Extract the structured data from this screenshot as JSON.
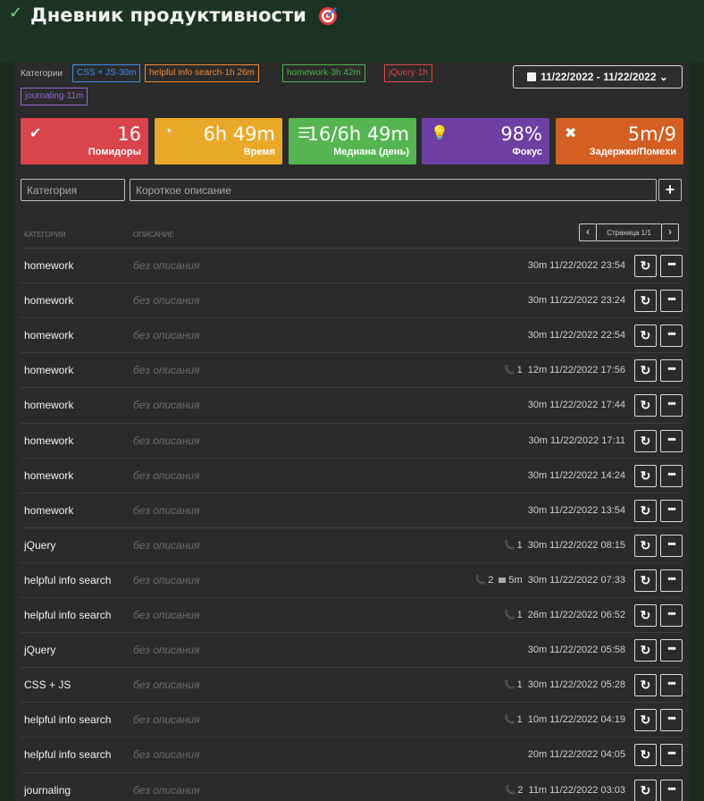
{
  "header": {
    "title": "Дневник продуктивности"
  },
  "categories": {
    "label": "Категории",
    "chips": [
      {
        "text": "CSS + JS·30m",
        "color": "blue"
      },
      {
        "text": "helpful info search·1h 26m",
        "color": "orange"
      },
      {
        "text": "homework·3h 42m",
        "color": "green"
      },
      {
        "text": "jQuery·1h",
        "color": "red"
      },
      {
        "text": "journaling·11m",
        "color": "purple"
      }
    ]
  },
  "daterange": {
    "value": "11/22/2022 - 11/22/2022"
  },
  "stats": [
    {
      "value": "16",
      "caption": "Помидоры",
      "color": "#d9434a",
      "icon": "check-circle-icon"
    },
    {
      "value": "6h 49m",
      "caption": "Время",
      "color": "#e9a828",
      "icon": "clock-icon"
    },
    {
      "value": "16/6h 49m",
      "caption": "Медиана (день)",
      "color": "#55b550",
      "icon": "list-icon"
    },
    {
      "value": "98%",
      "caption": "Фокус",
      "color": "#6e3fa3",
      "icon": "lightbulb-icon"
    },
    {
      "value": "5m/9",
      "caption": "Задержки/Помехи",
      "color": "#d35f22",
      "icon": "x-icon"
    }
  ],
  "form": {
    "category_placeholder": "Категория",
    "description_placeholder": "Короткое описание",
    "add_label": "+"
  },
  "table": {
    "col_category": "КАТЕГОРИЯ",
    "col_description": "ОПИСАНИЕ",
    "page_label": "Страница 1/1",
    "rows": [
      {
        "cat": "homework",
        "desc": "без описания",
        "calls": "",
        "delay": "",
        "dur": "30m",
        "date": "11/22/2022 23:54"
      },
      {
        "cat": "homework",
        "desc": "без описания",
        "calls": "",
        "delay": "",
        "dur": "30m",
        "date": "11/22/2022 23:24"
      },
      {
        "cat": "homework",
        "desc": "без описания",
        "calls": "",
        "delay": "",
        "dur": "30m",
        "date": "11/22/2022 22:54"
      },
      {
        "cat": "homework",
        "desc": "без описания",
        "calls": "1",
        "delay": "",
        "dur": "12m",
        "date": "11/22/2022 17:56"
      },
      {
        "cat": "homework",
        "desc": "без описания",
        "calls": "",
        "delay": "",
        "dur": "30m",
        "date": "11/22/2022 17:44"
      },
      {
        "cat": "homework",
        "desc": "без описания",
        "calls": "",
        "delay": "",
        "dur": "30m",
        "date": "11/22/2022 17:11"
      },
      {
        "cat": "homework",
        "desc": "без описания",
        "calls": "",
        "delay": "",
        "dur": "30m",
        "date": "11/22/2022 14:24"
      },
      {
        "cat": "homework",
        "desc": "без описания",
        "calls": "",
        "delay": "",
        "dur": "30m",
        "date": "11/22/2022 13:54"
      },
      {
        "cat": "jQuery",
        "desc": "без описания",
        "calls": "1",
        "delay": "",
        "dur": "30m",
        "date": "11/22/2022 08:15"
      },
      {
        "cat": "helpful info search",
        "desc": "без описания",
        "calls": "2",
        "delay": "5m",
        "dur": "30m",
        "date": "11/22/2022 07:33"
      },
      {
        "cat": "helpful info search",
        "desc": "без описания",
        "calls": "1",
        "delay": "",
        "dur": "26m",
        "date": "11/22/2022 06:52"
      },
      {
        "cat": "jQuery",
        "desc": "без описания",
        "calls": "",
        "delay": "",
        "dur": "30m",
        "date": "11/22/2022 05:58"
      },
      {
        "cat": "CSS + JS",
        "desc": "без описания",
        "calls": "1",
        "delay": "",
        "dur": "30m",
        "date": "11/22/2022 05:28"
      },
      {
        "cat": "helpful info search",
        "desc": "без описания",
        "calls": "1",
        "delay": "",
        "dur": "10m",
        "date": "11/22/2022 04:19"
      },
      {
        "cat": "helpful info search",
        "desc": "без описания",
        "calls": "",
        "delay": "",
        "dur": "20m",
        "date": "11/22/2022 04:05"
      },
      {
        "cat": "journaling",
        "desc": "без описания",
        "calls": "2",
        "delay": "",
        "dur": "11m",
        "date": "11/22/2022 03:03"
      }
    ]
  }
}
